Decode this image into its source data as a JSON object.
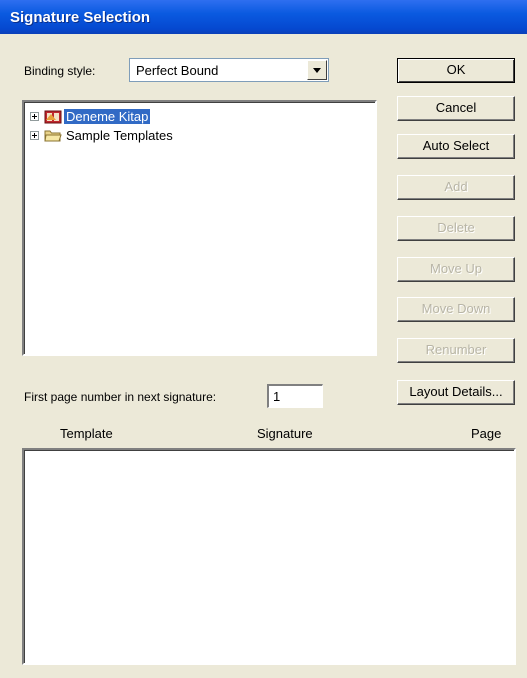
{
  "window": {
    "title": "Signature Selection"
  },
  "binding": {
    "label": "Binding style:",
    "value": "Perfect Bound"
  },
  "tree": {
    "items": [
      {
        "label": "Deneme Kitap",
        "icon": "book-icon",
        "selected": true
      },
      {
        "label": "Sample Templates",
        "icon": "folder-icon",
        "selected": false
      }
    ]
  },
  "buttons": {
    "ok": "OK",
    "cancel": "Cancel",
    "auto_select": "Auto Select",
    "add": "Add",
    "delete": "Delete",
    "move_up": "Move Up",
    "move_down": "Move Down",
    "renumber": "Renumber",
    "layout_details": "Layout Details..."
  },
  "first_page": {
    "label": "First page number in next signature:",
    "value": "1"
  },
  "columns": {
    "template": "Template",
    "signature": "Signature",
    "page": "Page"
  },
  "colors": {
    "titlebar": "#0a5ae0",
    "selection": "#316ac5",
    "dialog_bg": "#ece9d8"
  }
}
